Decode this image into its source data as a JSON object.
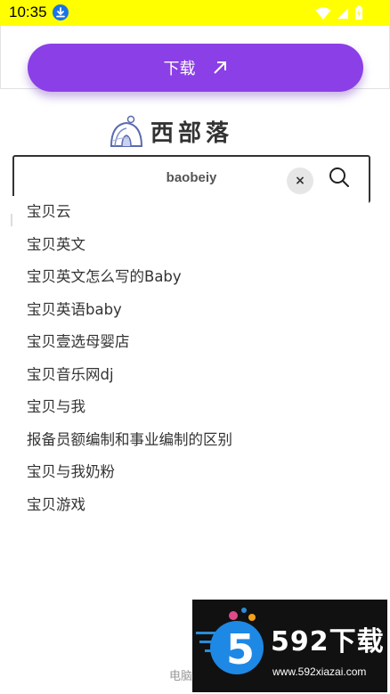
{
  "status_bar": {
    "time": "10:35",
    "background": "#ffff00"
  },
  "top_card": {
    "download_label": "下载",
    "button_color": "#8b3fe6"
  },
  "logo": {
    "text": "西部落",
    "icon": "igloo-logo-icon"
  },
  "search": {
    "query": "baobeiy",
    "clear_icon": "×",
    "search_icon": "magnifier-icon"
  },
  "suggestions": [
    "宝贝云",
    "宝贝英文",
    "宝贝英文怎么写的Baby",
    "宝贝英语baby",
    "宝贝壹选母婴店",
    "宝贝音乐网dj",
    "宝贝与我",
    "报备员额编制和事业编制的区别",
    "宝贝与我奶粉",
    "宝贝游戏"
  ],
  "footer": {
    "text": "电脑"
  },
  "watermark": {
    "text": "592下载",
    "url": "www.592xiazai.com",
    "logo_digit": "5"
  }
}
